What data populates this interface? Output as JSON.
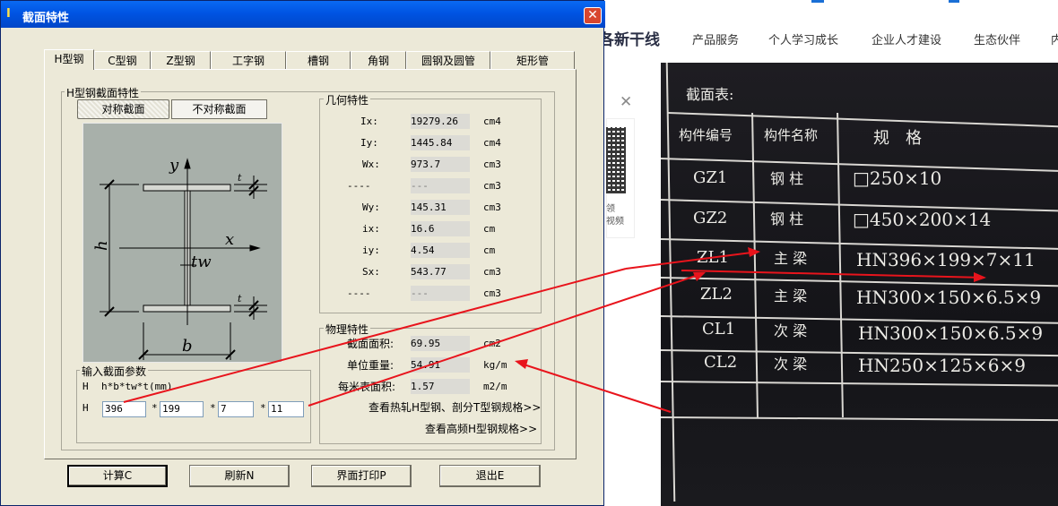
{
  "web": {
    "brand": "各新干线",
    "nav": [
      "产品服务",
      "个人学习成长",
      "企业人才建设",
      "生态伙伴",
      "内"
    ],
    "side_lines": [
      "领",
      "视频"
    ]
  },
  "photo": {
    "title": "截面表:",
    "headers": [
      "构件编号",
      "构件名称",
      "规　格"
    ],
    "rows": [
      [
        "GZ1",
        "钢 柱",
        "□250×10"
      ],
      [
        "GZ2",
        "钢 柱",
        "□450×200×14"
      ],
      [
        "ZL1",
        "主 梁",
        "HN396×199×7×11"
      ],
      [
        "ZL2",
        "主 梁",
        "HN300×150×6.5×9"
      ],
      [
        "CL1",
        "次 梁",
        "HN300×150×6.5×9"
      ],
      [
        "CL2",
        "次 梁",
        "HN250×125×6×9"
      ]
    ]
  },
  "dialog": {
    "title_icon": "I",
    "title": "截面特性",
    "tabs": [
      "H型钢",
      "C型钢",
      "Z型钢",
      "工字钢",
      "槽钢",
      "角钢",
      "圆钢及圆管",
      "矩形管"
    ],
    "active_tab": "H型钢",
    "section_group": "H型钢截面特性",
    "sym_button": "对称截面",
    "asym_button": "不对称截面",
    "drawing_labels": {
      "y": "y",
      "x": "x",
      "h": "h",
      "tw": "tw",
      "b": "b",
      "t1": "t",
      "t2": "t"
    },
    "geometry": {
      "title": "几何特性",
      "rows": [
        {
          "label": "Ix:",
          "value": "19279.26",
          "unit": "cm4"
        },
        {
          "label": "Iy:",
          "value": "1445.84",
          "unit": "cm4"
        },
        {
          "label": "Wx:",
          "value": "973.7",
          "unit": "cm3"
        },
        {
          "label": "----",
          "value": "---",
          "unit": "cm3"
        },
        {
          "label": "Wy:",
          "value": "145.31",
          "unit": "cm3"
        },
        {
          "label": "ix:",
          "value": "16.6",
          "unit": "cm"
        },
        {
          "label": "iy:",
          "value": "4.54",
          "unit": "cm"
        },
        {
          "label": "Sx:",
          "value": "543.77",
          "unit": "cm3"
        },
        {
          "label": "----",
          "value": "---",
          "unit": "cm3"
        }
      ]
    },
    "physics": {
      "title": "物理特性",
      "rows": [
        {
          "label": "截面面积:",
          "value": "69.95",
          "unit": "cm2"
        },
        {
          "label": "单位重量:",
          "value": "54.91",
          "unit": "kg/m"
        },
        {
          "label": "每米表面积:",
          "value": "1.57",
          "unit": "m2/m"
        }
      ],
      "link1": "查看热轧H型钢、剖分T型钢规格>>",
      "link2": "查看高频H型钢规格>>"
    },
    "input": {
      "title": "输入截面参数",
      "h_label": "H",
      "formula": "h*b*tw*t(mm)",
      "row_label": "H",
      "h": "396",
      "b": "199",
      "tw": "7",
      "t": "11",
      "sep": "*"
    },
    "buttons": {
      "calc": "计算C",
      "refresh": "刷新N",
      "print": "界面打印P",
      "exit": "退出E"
    }
  },
  "colors": {
    "title_blue": "#0054e3",
    "arrow_red": "#e8141c",
    "dialog_bg": "#ece9d8"
  }
}
